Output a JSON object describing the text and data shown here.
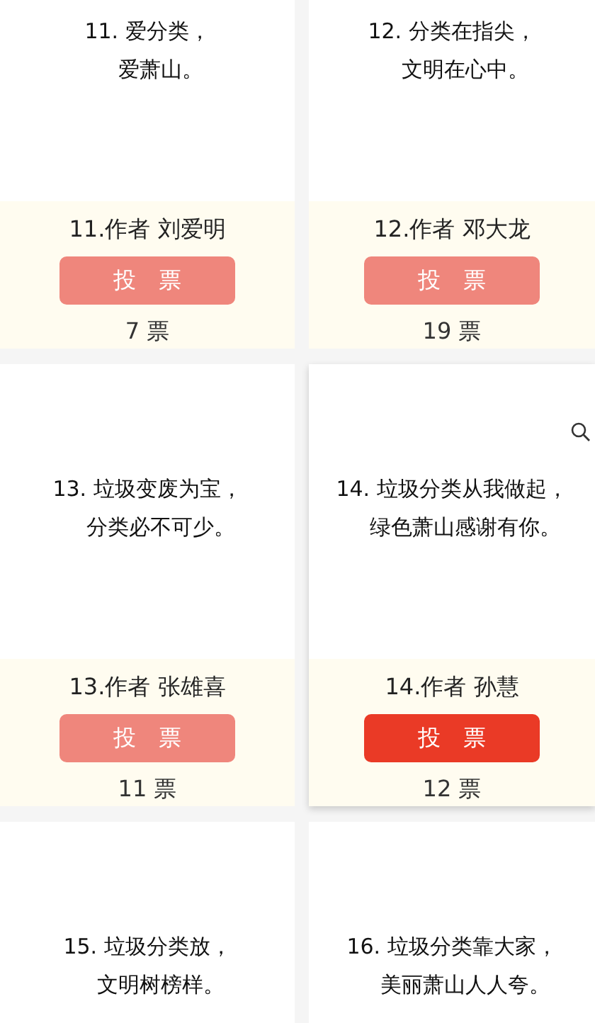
{
  "entries": [
    {
      "slogan": [
        "11. 爱分类，",
        "爱萧山。"
      ],
      "author": "11.作者 刘爱明",
      "vote_button": "投票",
      "votes": "7 票",
      "selected": false
    },
    {
      "slogan": [
        "12. 分类在指尖，",
        "文明在心中。"
      ],
      "author": "12.作者 邓大龙",
      "vote_button": "投票",
      "votes": "19 票",
      "selected": false
    },
    {
      "slogan": [
        "13. 垃圾变废为宝，",
        "分类必不可少。"
      ],
      "author": "13.作者 张雄喜",
      "vote_button": "投票",
      "votes": "11 票",
      "selected": false
    },
    {
      "slogan": [
        "14. 垃圾分类从我做起，",
        "绿色萧山感谢有你。"
      ],
      "author": "14.作者 孙慧",
      "vote_button": "投票",
      "votes": "12 票",
      "selected": true
    },
    {
      "slogan": [
        "15. 垃圾分类放，",
        "文明树榜样。"
      ],
      "selected": false
    },
    {
      "slogan": [
        "16. 垃圾分类靠大家，",
        "美丽萧山人人夸。"
      ],
      "selected": false
    }
  ]
}
